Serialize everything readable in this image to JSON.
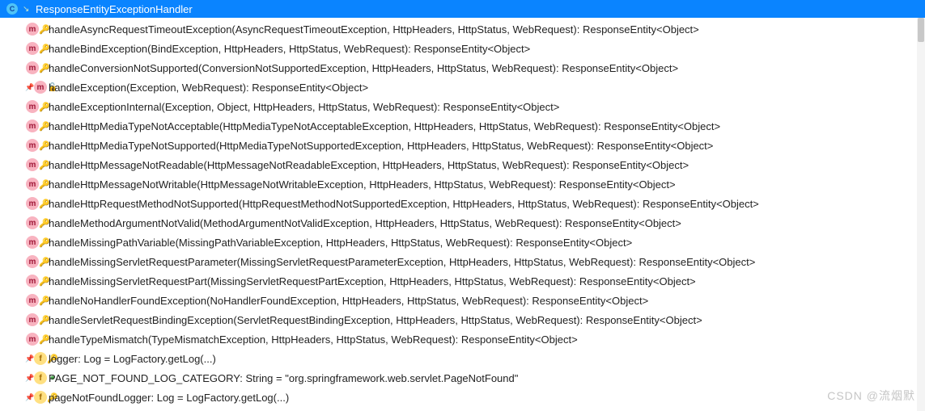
{
  "header": {
    "title": "ResponseEntityExceptionHandler"
  },
  "members": [
    {
      "kind": "m",
      "vis": "protected",
      "locked": false,
      "pinned": false,
      "signature": "handleAsyncRequestTimeoutException(AsyncRequestTimeoutException, HttpHeaders, HttpStatus, WebRequest): ResponseEntity<Object>"
    },
    {
      "kind": "m",
      "vis": "protected",
      "locked": false,
      "pinned": false,
      "signature": "handleBindException(BindException, HttpHeaders, HttpStatus, WebRequest): ResponseEntity<Object>"
    },
    {
      "kind": "m",
      "vis": "protected",
      "locked": false,
      "pinned": false,
      "signature": "handleConversionNotSupported(ConversionNotSupportedException, HttpHeaders, HttpStatus, WebRequest): ResponseEntity<Object>"
    },
    {
      "kind": "m",
      "vis": "public",
      "locked": true,
      "pinned": true,
      "signature": "handleException(Exception, WebRequest): ResponseEntity<Object>"
    },
    {
      "kind": "m",
      "vis": "protected",
      "locked": false,
      "pinned": false,
      "signature": "handleExceptionInternal(Exception, Object, HttpHeaders, HttpStatus, WebRequest): ResponseEntity<Object>"
    },
    {
      "kind": "m",
      "vis": "protected",
      "locked": false,
      "pinned": false,
      "signature": "handleHttpMediaTypeNotAcceptable(HttpMediaTypeNotAcceptableException, HttpHeaders, HttpStatus, WebRequest): ResponseEntity<Object>"
    },
    {
      "kind": "m",
      "vis": "protected",
      "locked": false,
      "pinned": false,
      "signature": "handleHttpMediaTypeNotSupported(HttpMediaTypeNotSupportedException, HttpHeaders, HttpStatus, WebRequest): ResponseEntity<Object>"
    },
    {
      "kind": "m",
      "vis": "protected",
      "locked": false,
      "pinned": false,
      "signature": "handleHttpMessageNotReadable(HttpMessageNotReadableException, HttpHeaders, HttpStatus, WebRequest): ResponseEntity<Object>"
    },
    {
      "kind": "m",
      "vis": "protected",
      "locked": false,
      "pinned": false,
      "signature": "handleHttpMessageNotWritable(HttpMessageNotWritableException, HttpHeaders, HttpStatus, WebRequest): ResponseEntity<Object>"
    },
    {
      "kind": "m",
      "vis": "protected",
      "locked": false,
      "pinned": false,
      "signature": "handleHttpRequestMethodNotSupported(HttpRequestMethodNotSupportedException, HttpHeaders, HttpStatus, WebRequest): ResponseEntity<Object>"
    },
    {
      "kind": "m",
      "vis": "protected",
      "locked": false,
      "pinned": false,
      "signature": "handleMethodArgumentNotValid(MethodArgumentNotValidException, HttpHeaders, HttpStatus, WebRequest): ResponseEntity<Object>"
    },
    {
      "kind": "m",
      "vis": "protected",
      "locked": false,
      "pinned": false,
      "signature": "handleMissingPathVariable(MissingPathVariableException, HttpHeaders, HttpStatus, WebRequest): ResponseEntity<Object>"
    },
    {
      "kind": "m",
      "vis": "protected",
      "locked": false,
      "pinned": false,
      "signature": "handleMissingServletRequestParameter(MissingServletRequestParameterException, HttpHeaders, HttpStatus, WebRequest): ResponseEntity<Object>"
    },
    {
      "kind": "m",
      "vis": "protected",
      "locked": false,
      "pinned": false,
      "signature": "handleMissingServletRequestPart(MissingServletRequestPartException, HttpHeaders, HttpStatus, WebRequest): ResponseEntity<Object>"
    },
    {
      "kind": "m",
      "vis": "protected",
      "locked": false,
      "pinned": false,
      "signature": "handleNoHandlerFoundException(NoHandlerFoundException, HttpHeaders, HttpStatus, WebRequest): ResponseEntity<Object>"
    },
    {
      "kind": "m",
      "vis": "protected",
      "locked": false,
      "pinned": false,
      "signature": "handleServletRequestBindingException(ServletRequestBindingException, HttpHeaders, HttpStatus, WebRequest): ResponseEntity<Object>"
    },
    {
      "kind": "m",
      "vis": "protected",
      "locked": false,
      "pinned": false,
      "signature": "handleTypeMismatch(TypeMismatchException, HttpHeaders, HttpStatus, WebRequest): ResponseEntity<Object>"
    },
    {
      "kind": "f",
      "vis": "protected",
      "locked": false,
      "pinned": true,
      "signature": "logger: Log = LogFactory.getLog(...)"
    },
    {
      "kind": "f",
      "vis": "public",
      "locked": false,
      "pinned": true,
      "signature": "PAGE_NOT_FOUND_LOG_CATEGORY: String = \"org.springframework.web.servlet.PageNotFound\""
    },
    {
      "kind": "f",
      "vis": "protected",
      "locked": false,
      "pinned": true,
      "signature": "pageNotFoundLogger: Log = LogFactory.getLog(...)"
    }
  ],
  "watermark": "CSDN @流烟默"
}
